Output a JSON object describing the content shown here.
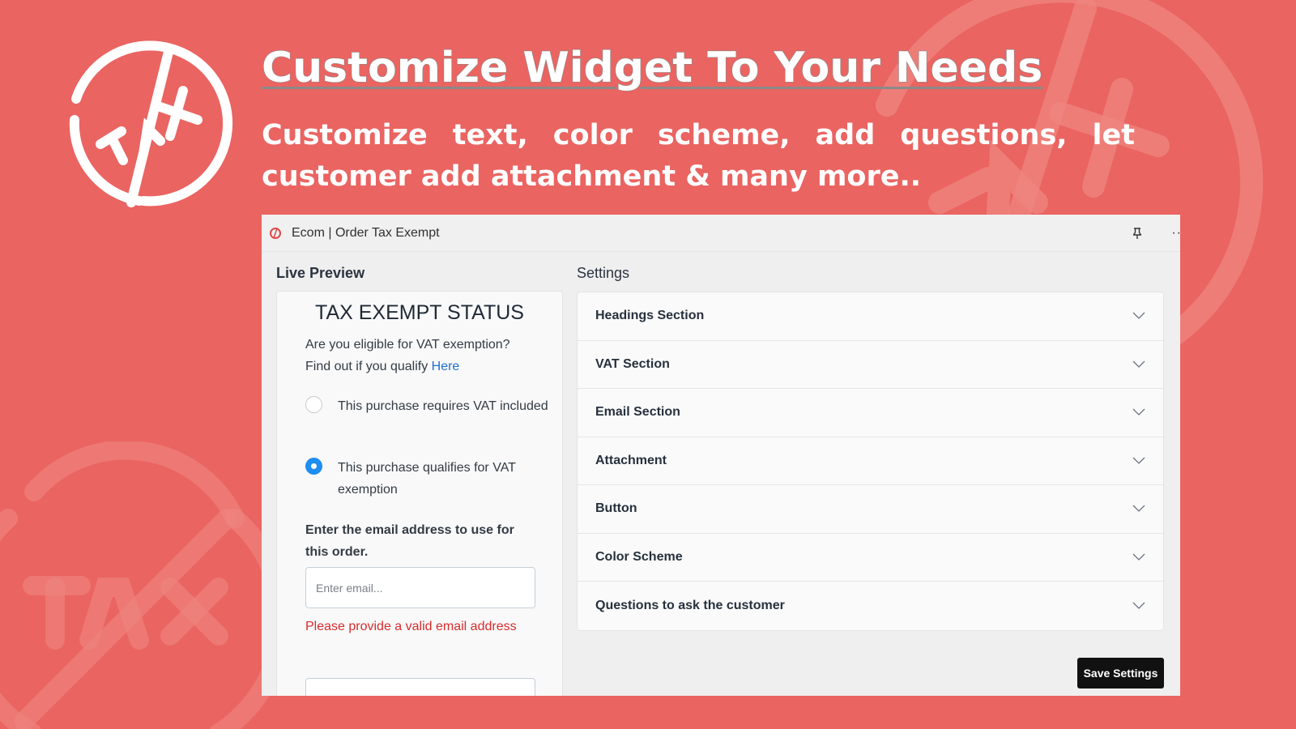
{
  "banner": {
    "headline": "Customize Widget To Your Needs",
    "subheadline": "Customize text, color scheme, add questions, let customer add attachment & many more..",
    "logo_text": "TAX",
    "background_color": "#EA6461"
  },
  "window": {
    "title": "Ecom | Order Tax Exempt",
    "icons": [
      "app-logo-icon",
      "pin-icon",
      "more-icon"
    ],
    "more_label": "··"
  },
  "live_preview": {
    "label": "Live Preview",
    "widget": {
      "title": "TAX EXEMPT STATUS",
      "question": "Are you eligible for VAT exemption?",
      "qualify_prefix": "Find out if you qualify ",
      "qualify_link": "Here",
      "options": [
        {
          "label": "This purchase requires VAT included",
          "selected": false
        },
        {
          "label": "This purchase qualifies for VAT exemption",
          "selected": true
        }
      ],
      "email_label": "Enter the email address to use for this order.",
      "email_value": "",
      "email_placeholder": "Enter email...",
      "email_error": "Please provide a valid email address"
    }
  },
  "settings": {
    "label": "Settings",
    "sections": [
      {
        "label": "Headings Section",
        "expanded": false
      },
      {
        "label": "VAT Section",
        "expanded": false
      },
      {
        "label": "Email Section",
        "expanded": false
      },
      {
        "label": "Attachment",
        "expanded": false
      },
      {
        "label": "Button",
        "expanded": false
      },
      {
        "label": "Color Scheme",
        "expanded": false
      },
      {
        "label": "Questions to ask the customer",
        "expanded": false
      }
    ],
    "save_label": "Save Settings"
  },
  "colors": {
    "accent_blue": "#1E8EF0",
    "link_blue": "#1F6FD1",
    "error_red": "#D82C2C",
    "save_button": "#111111"
  }
}
